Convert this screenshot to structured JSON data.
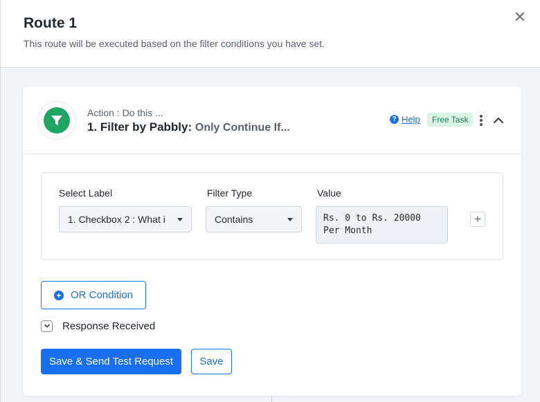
{
  "modal": {
    "title": "Route 1",
    "subtitle": "This route will be executed based on the filter conditions you have set.",
    "close_icon": "close-icon",
    "close_glyph": "✕"
  },
  "action": {
    "app_icon": "filter-icon",
    "kicker": "Action : Do this ...",
    "title": "1. Filter by Pabbly:",
    "subtitle": "Only Continue If...",
    "help_label": "Help",
    "help_icon": "question-circle-icon",
    "help_icon_glyph": "?",
    "badge": "Free Task",
    "more_icon": "kebab-menu-icon",
    "collapse_icon": "chevron-up-icon"
  },
  "filter": {
    "select_label_heading": "Select Label",
    "select_label_value": "1. Checkbox 2 : What i",
    "filter_type_heading": "Filter Type",
    "filter_type_value": "Contains",
    "value_heading": "Value",
    "value_text": "Rs. 0 to Rs. 20000 Per Month",
    "add_glyph": "+"
  },
  "or_condition": {
    "label": "OR Condition",
    "icon": "plus-circle-icon",
    "icon_glyph": "+"
  },
  "response": {
    "label": "Response Received",
    "icon": "chevron-down-icon"
  },
  "buttons": {
    "save_send": "Save & Send Test Request",
    "save": "Save"
  },
  "colors": {
    "accent": "#1a6ff0",
    "filter_app": "#1fa463",
    "badge_bg": "#d8f5e6",
    "badge_text": "#1b7f4c"
  }
}
